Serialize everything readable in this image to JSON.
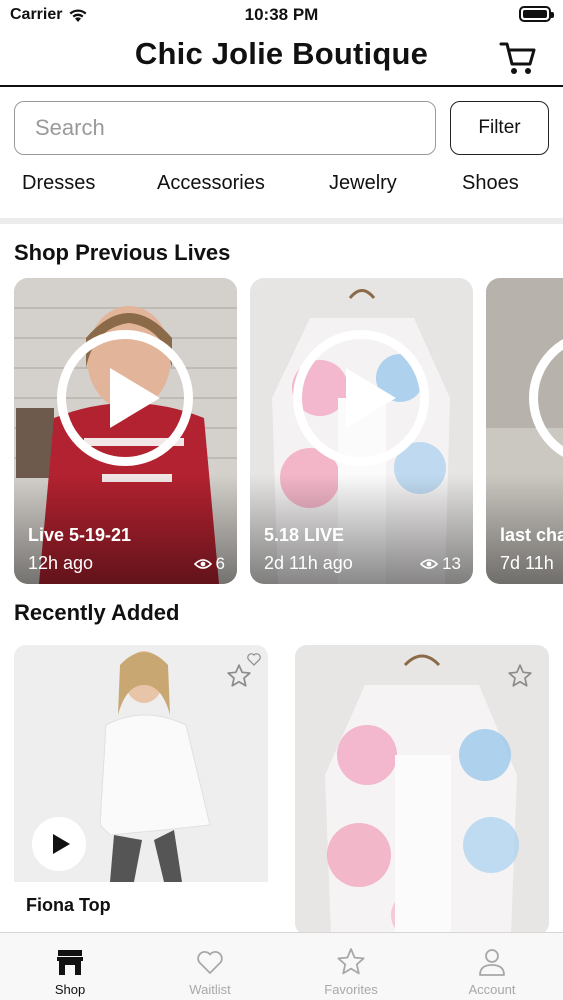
{
  "status_bar": {
    "carrier": "Carrier",
    "time": "10:38 PM"
  },
  "header": {
    "title": "Chic Jolie Boutique",
    "cart_icon": "cart-icon"
  },
  "search": {
    "placeholder": "Search",
    "value": "",
    "filter_label": "Filter"
  },
  "categories": [
    "Dresses",
    "Accessories",
    "Jewelry",
    "Shoes"
  ],
  "previous_lives": {
    "title": "Shop Previous Lives",
    "items": [
      {
        "title": "Live 5-19-21",
        "time": "12h ago",
        "views": "6"
      },
      {
        "title": "5.18 LIVE",
        "time": "2d 11h ago",
        "views": "13"
      },
      {
        "title": "last cha",
        "time": "7d 11h"
      }
    ]
  },
  "recently_added": {
    "title": "Recently Added",
    "items": [
      {
        "name": "Fiona Top"
      }
    ]
  },
  "tabs": [
    {
      "label": "Shop",
      "icon": "storefront-icon",
      "active": true
    },
    {
      "label": "Waitlist",
      "icon": "heart-icon",
      "active": false
    },
    {
      "label": "Favorites",
      "icon": "star-icon",
      "active": false
    },
    {
      "label": "Account",
      "icon": "person-icon",
      "active": false
    }
  ],
  "colors": {
    "accent": "#111111",
    "inactive_tab": "#a8a8a8",
    "band": "#ececec"
  }
}
